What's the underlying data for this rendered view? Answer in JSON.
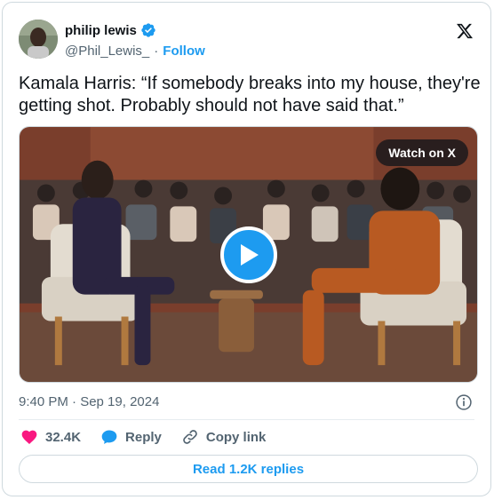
{
  "author": {
    "name": "philip lewis",
    "handle": "@Phil_Lewis_",
    "separator": "·",
    "follow_label": "Follow"
  },
  "tweet": {
    "text": "Kamala Harris: “If somebody breaks into my house, they're getting shot. Probably should not have said that.”"
  },
  "media": {
    "watch_label": "Watch on X"
  },
  "meta": {
    "timestamp": "9:40 PM · Sep 19, 2024"
  },
  "actions": {
    "likes": "32.4K",
    "reply_label": "Reply",
    "copy_label": "Copy link"
  },
  "replies_button": "Read 1.2K replies",
  "colors": {
    "accent": "#1d9bf0",
    "like": "#f91880",
    "text": "#0f1419",
    "secondary": "#536471"
  }
}
